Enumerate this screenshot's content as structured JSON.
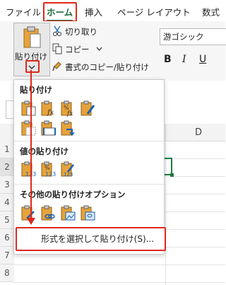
{
  "tabs": [
    "ファイル",
    "ホーム",
    "挿入",
    "ページ レイアウト",
    "数式"
  ],
  "active_tab": "ホーム",
  "clipboard": {
    "paste_label": "貼り付け",
    "cut_label": "切り取り",
    "copy_label": "コピー",
    "format_painter_label": "書式のコピー/貼り付け"
  },
  "font": {
    "name": "游ゴシック",
    "bold": "B",
    "italic": "I",
    "underline": "U"
  },
  "sheet": {
    "column_d": "D",
    "rows": [
      "1",
      "2",
      "3",
      "4",
      "5",
      "6",
      "7",
      "8"
    ]
  },
  "paste_menu": {
    "section_paste": "貼り付け",
    "section_values": "値の貼り付け",
    "section_other": "その他の貼り付けオプション",
    "paste_special": "形式を選択して貼り付け(S)..."
  },
  "colors": {
    "accent": "#1f7a44",
    "highlight": "#e0281c",
    "clipboard": "#e6a33a"
  }
}
